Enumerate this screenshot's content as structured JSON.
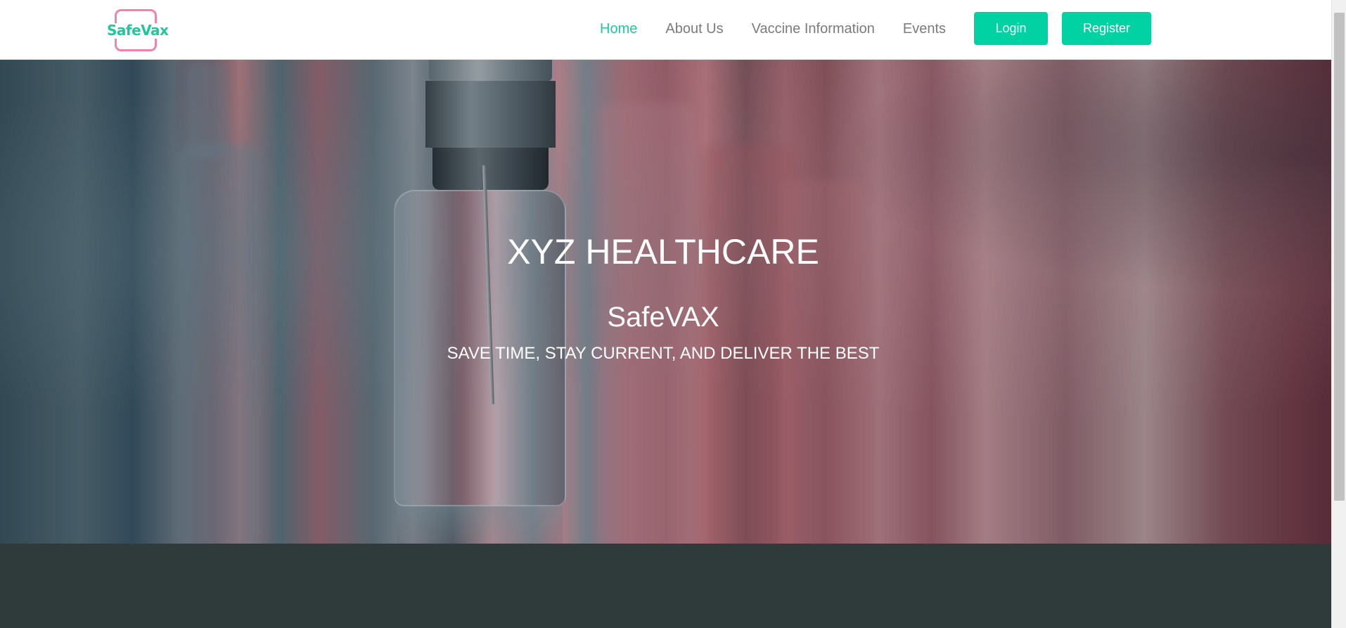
{
  "brand": {
    "logo_text": "SafeVax",
    "logo_frame_color": "#f083a8",
    "logo_text_color": "#1fc79a"
  },
  "nav": {
    "links": [
      {
        "label": "Home",
        "active": true
      },
      {
        "label": "About Us",
        "active": false
      },
      {
        "label": "Vaccine Information",
        "active": false
      },
      {
        "label": "Events",
        "active": false
      }
    ],
    "login_label": "Login",
    "register_label": "Register",
    "accent_color": "#00d2a3"
  },
  "hero": {
    "title": "XYZ HEALTHCARE",
    "brand": "SafeVAX",
    "tagline": "SAVE TIME, STAY CURRENT, AND DELIVER THE BEST",
    "image": "vaccine-vials-photo"
  },
  "footer_band": {
    "color": "#2e3b3a"
  }
}
